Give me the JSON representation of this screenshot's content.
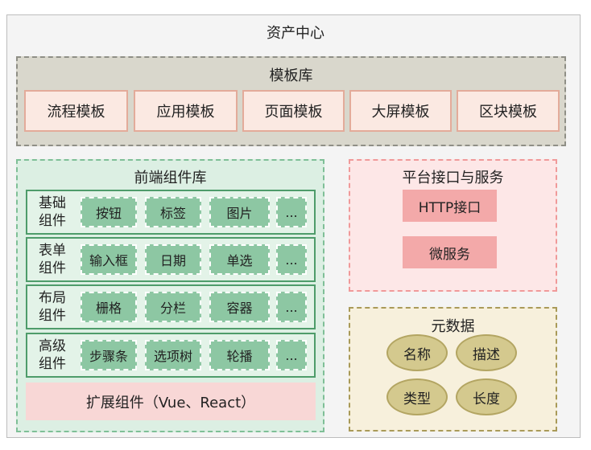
{
  "title": "资产中心",
  "template_library": {
    "title": "模板库",
    "items": [
      "流程模板",
      "应用模板",
      "页面模板",
      "大屏模板",
      "区块模板"
    ]
  },
  "frontend": {
    "title": "前端组件库",
    "rows": [
      {
        "label_line1": "基础",
        "label_line2": "组件",
        "chips": [
          "按钮",
          "标签",
          "图片",
          "..."
        ]
      },
      {
        "label_line1": "表单",
        "label_line2": "组件",
        "chips": [
          "输入框",
          "日期",
          "单选",
          "..."
        ]
      },
      {
        "label_line1": "布局",
        "label_line2": "组件",
        "chips": [
          "栅格",
          "分栏",
          "容器",
          "..."
        ]
      },
      {
        "label_line1": "高级",
        "label_line2": "组件",
        "chips": [
          "步骤条",
          "选项树",
          "轮播",
          "..."
        ]
      }
    ],
    "extension": "扩展组件（Vue、React）"
  },
  "platform": {
    "title": "平台接口与服务",
    "items": [
      "HTTP接口",
      "微服务"
    ]
  },
  "metadata": {
    "title": "元数据",
    "items": [
      "名称",
      "描述",
      "类型",
      "长度"
    ]
  }
}
